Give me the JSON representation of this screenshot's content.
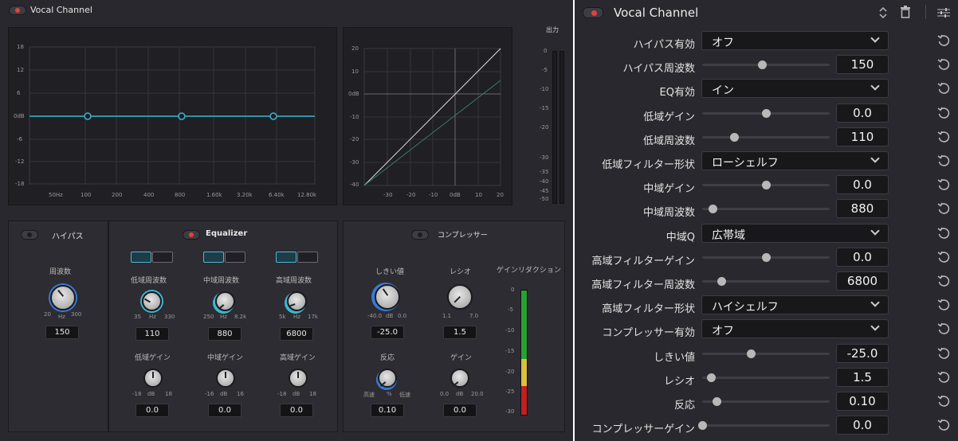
{
  "left": {
    "title": "Vocal Channel",
    "output_label": "出力",
    "eq_graph": {
      "y_ticks": [
        "18",
        "12",
        "6",
        "0dB",
        "-6",
        "-12",
        "-18"
      ],
      "x_ticks": [
        "50Hz",
        "100",
        "200",
        "400",
        "800",
        "1.60k",
        "3.20k",
        "6.40k",
        "12.80k"
      ]
    },
    "comp_graph": {
      "y_ticks": [
        "20",
        "10",
        "0dB",
        "-10",
        "-20",
        "-30",
        "-40"
      ],
      "x_ticks": [
        "-30",
        "-20",
        "-10",
        "0dB",
        "10",
        "20"
      ]
    },
    "meter_ticks": [
      "0",
      "-5",
      "-10",
      "-15",
      "-20",
      "-30",
      "-35",
      "-40",
      "-45",
      "-50"
    ],
    "highpass": {
      "title": "ハイパス",
      "freq_label": "周波数",
      "min": "20",
      "unit": "Hz",
      "max": "300",
      "value": "150"
    },
    "eq": {
      "title": "Equalizer",
      "low_freq_label": "低域周波数",
      "low_freq_min": "35",
      "low_freq_unit": "Hz",
      "low_freq_max": "330",
      "low_freq_value": "110",
      "mid_freq_label": "中域周波数",
      "mid_freq_min": "250",
      "mid_freq_unit": "Hz",
      "mid_freq_max": "8.2k",
      "mid_freq_value": "880",
      "high_freq_label": "高域周波数",
      "high_freq_min": "5k",
      "high_freq_unit": "Hz",
      "high_freq_max": "17k",
      "high_freq_value": "6800",
      "low_gain_label": "低域ゲイン",
      "mid_gain_label": "中域ゲイン",
      "high_gain_label": "高域ゲイン",
      "low_gain_min": "-18",
      "mid_gain_min": "-16",
      "high_gain_min": "-18",
      "gain_unit": "dB",
      "low_gain_max": "18",
      "mid_gain_max": "16",
      "high_gain_max": "18",
      "low_gain_value": "0.0",
      "mid_gain_value": "0.0",
      "high_gain_value": "0.0"
    },
    "comp": {
      "title": "コンプレッサー",
      "threshold_label": "しきい値",
      "threshold_min": "-40.0",
      "threshold_unit": "dB",
      "threshold_max": "0.0",
      "threshold_value": "-25.0",
      "ratio_label": "レシオ",
      "ratio_min": "1.1",
      "ratio_max": "7.0",
      "ratio_value": "1.5",
      "response_label": "反応",
      "response_min": "高速",
      "response_unit": "%",
      "response_max": "低速",
      "response_value": "0.10",
      "gain_label": "ゲイン",
      "gain_min": "0.0",
      "gain_unit": "dB",
      "gain_max": "20.0",
      "gain_value": "0.0",
      "gr_label": "ゲインリダクション",
      "gr_ticks": [
        "0",
        "-5",
        "-10",
        "-15",
        "-20",
        "-25",
        "-30"
      ]
    }
  },
  "inspector": {
    "title": "Vocal Channel",
    "rows": [
      {
        "label": "ハイパス有効",
        "type": "dropdown",
        "value": "オフ"
      },
      {
        "label": "ハイパス周波数",
        "type": "slider",
        "value": "150",
        "level": 0.47
      },
      {
        "label": "EQ有効",
        "type": "dropdown",
        "value": "イン"
      },
      {
        "label": "低域ゲイン",
        "type": "slider",
        "value": "0.0",
        "level": 0.5
      },
      {
        "label": "低域周波数",
        "type": "slider",
        "value": "110",
        "level": 0.25
      },
      {
        "label": "低域フィルター形状",
        "type": "dropdown",
        "value": "ローシェルフ"
      },
      {
        "label": "中域ゲイン",
        "type": "slider",
        "value": "0.0",
        "level": 0.5
      },
      {
        "label": "中域周波数",
        "type": "slider",
        "value": "880",
        "level": 0.08
      },
      {
        "label": "中域Q",
        "type": "dropdown",
        "value": "広帯域"
      },
      {
        "label": "高域フィルターゲイン",
        "type": "slider",
        "value": "0.0",
        "level": 0.5
      },
      {
        "label": "高域フィルター周波数",
        "type": "slider",
        "value": "6800",
        "level": 0.15
      },
      {
        "label": "高域フィルター形状",
        "type": "dropdown",
        "value": "ハイシェルフ"
      },
      {
        "label": "コンプレッサー有効",
        "type": "dropdown",
        "value": "オフ"
      },
      {
        "label": "しきい値",
        "type": "slider",
        "value": "-25.0",
        "level": 0.38
      },
      {
        "label": "レシオ",
        "type": "slider",
        "value": "1.5",
        "level": 0.07
      },
      {
        "label": "反応",
        "type": "slider",
        "value": "0.10",
        "level": 0.11
      },
      {
        "label": "コンプレッサーゲイン",
        "type": "slider",
        "value": "0.0",
        "level": 0.0
      }
    ]
  }
}
